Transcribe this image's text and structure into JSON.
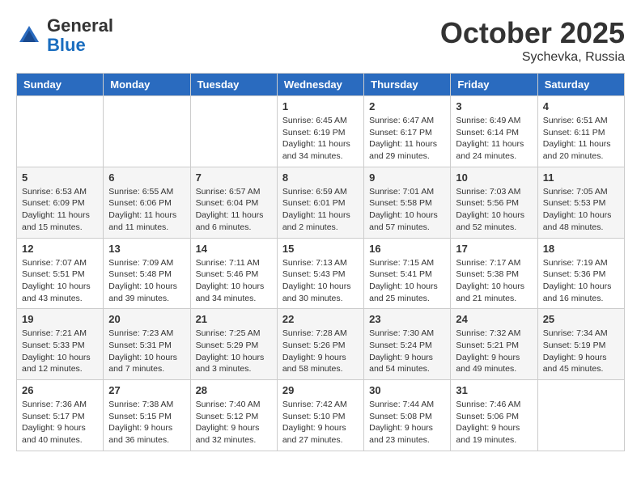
{
  "logo": {
    "general": "General",
    "blue": "Blue"
  },
  "title": "October 2025",
  "subtitle": "Sychevka, Russia",
  "headers": [
    "Sunday",
    "Monday",
    "Tuesday",
    "Wednesday",
    "Thursday",
    "Friday",
    "Saturday"
  ],
  "weeks": [
    [
      {
        "day": "",
        "info": ""
      },
      {
        "day": "",
        "info": ""
      },
      {
        "day": "",
        "info": ""
      },
      {
        "day": "1",
        "info": "Sunrise: 6:45 AM\nSunset: 6:19 PM\nDaylight: 11 hours\nand 34 minutes."
      },
      {
        "day": "2",
        "info": "Sunrise: 6:47 AM\nSunset: 6:17 PM\nDaylight: 11 hours\nand 29 minutes."
      },
      {
        "day": "3",
        "info": "Sunrise: 6:49 AM\nSunset: 6:14 PM\nDaylight: 11 hours\nand 24 minutes."
      },
      {
        "day": "4",
        "info": "Sunrise: 6:51 AM\nSunset: 6:11 PM\nDaylight: 11 hours\nand 20 minutes."
      }
    ],
    [
      {
        "day": "5",
        "info": "Sunrise: 6:53 AM\nSunset: 6:09 PM\nDaylight: 11 hours\nand 15 minutes."
      },
      {
        "day": "6",
        "info": "Sunrise: 6:55 AM\nSunset: 6:06 PM\nDaylight: 11 hours\nand 11 minutes."
      },
      {
        "day": "7",
        "info": "Sunrise: 6:57 AM\nSunset: 6:04 PM\nDaylight: 11 hours\nand 6 minutes."
      },
      {
        "day": "8",
        "info": "Sunrise: 6:59 AM\nSunset: 6:01 PM\nDaylight: 11 hours\nand 2 minutes."
      },
      {
        "day": "9",
        "info": "Sunrise: 7:01 AM\nSunset: 5:58 PM\nDaylight: 10 hours\nand 57 minutes."
      },
      {
        "day": "10",
        "info": "Sunrise: 7:03 AM\nSunset: 5:56 PM\nDaylight: 10 hours\nand 52 minutes."
      },
      {
        "day": "11",
        "info": "Sunrise: 7:05 AM\nSunset: 5:53 PM\nDaylight: 10 hours\nand 48 minutes."
      }
    ],
    [
      {
        "day": "12",
        "info": "Sunrise: 7:07 AM\nSunset: 5:51 PM\nDaylight: 10 hours\nand 43 minutes."
      },
      {
        "day": "13",
        "info": "Sunrise: 7:09 AM\nSunset: 5:48 PM\nDaylight: 10 hours\nand 39 minutes."
      },
      {
        "day": "14",
        "info": "Sunrise: 7:11 AM\nSunset: 5:46 PM\nDaylight: 10 hours\nand 34 minutes."
      },
      {
        "day": "15",
        "info": "Sunrise: 7:13 AM\nSunset: 5:43 PM\nDaylight: 10 hours\nand 30 minutes."
      },
      {
        "day": "16",
        "info": "Sunrise: 7:15 AM\nSunset: 5:41 PM\nDaylight: 10 hours\nand 25 minutes."
      },
      {
        "day": "17",
        "info": "Sunrise: 7:17 AM\nSunset: 5:38 PM\nDaylight: 10 hours\nand 21 minutes."
      },
      {
        "day": "18",
        "info": "Sunrise: 7:19 AM\nSunset: 5:36 PM\nDaylight: 10 hours\nand 16 minutes."
      }
    ],
    [
      {
        "day": "19",
        "info": "Sunrise: 7:21 AM\nSunset: 5:33 PM\nDaylight: 10 hours\nand 12 minutes."
      },
      {
        "day": "20",
        "info": "Sunrise: 7:23 AM\nSunset: 5:31 PM\nDaylight: 10 hours\nand 7 minutes."
      },
      {
        "day": "21",
        "info": "Sunrise: 7:25 AM\nSunset: 5:29 PM\nDaylight: 10 hours\nand 3 minutes."
      },
      {
        "day": "22",
        "info": "Sunrise: 7:28 AM\nSunset: 5:26 PM\nDaylight: 9 hours\nand 58 minutes."
      },
      {
        "day": "23",
        "info": "Sunrise: 7:30 AM\nSunset: 5:24 PM\nDaylight: 9 hours\nand 54 minutes."
      },
      {
        "day": "24",
        "info": "Sunrise: 7:32 AM\nSunset: 5:21 PM\nDaylight: 9 hours\nand 49 minutes."
      },
      {
        "day": "25",
        "info": "Sunrise: 7:34 AM\nSunset: 5:19 PM\nDaylight: 9 hours\nand 45 minutes."
      }
    ],
    [
      {
        "day": "26",
        "info": "Sunrise: 7:36 AM\nSunset: 5:17 PM\nDaylight: 9 hours\nand 40 minutes."
      },
      {
        "day": "27",
        "info": "Sunrise: 7:38 AM\nSunset: 5:15 PM\nDaylight: 9 hours\nand 36 minutes."
      },
      {
        "day": "28",
        "info": "Sunrise: 7:40 AM\nSunset: 5:12 PM\nDaylight: 9 hours\nand 32 minutes."
      },
      {
        "day": "29",
        "info": "Sunrise: 7:42 AM\nSunset: 5:10 PM\nDaylight: 9 hours\nand 27 minutes."
      },
      {
        "day": "30",
        "info": "Sunrise: 7:44 AM\nSunset: 5:08 PM\nDaylight: 9 hours\nand 23 minutes."
      },
      {
        "day": "31",
        "info": "Sunrise: 7:46 AM\nSunset: 5:06 PM\nDaylight: 9 hours\nand 19 minutes."
      },
      {
        "day": "",
        "info": ""
      }
    ]
  ]
}
